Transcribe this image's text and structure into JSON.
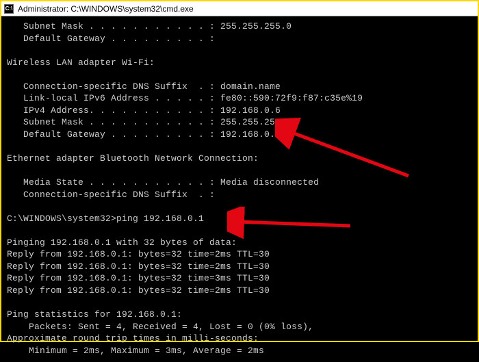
{
  "window": {
    "title": "Administrator: C:\\WINDOWS\\system32\\cmd.exe",
    "icon_label": "C:\\"
  },
  "terminal_lines": [
    "   Subnet Mask . . . . . . . . . . . : 255.255.255.0",
    "   Default Gateway . . . . . . . . . :",
    "",
    "Wireless LAN adapter Wi-Fi:",
    "",
    "   Connection-specific DNS Suffix  . : domain.name",
    "   Link-local IPv6 Address . . . . . : fe80::590:72f9:f87:c35e%19",
    "   IPv4 Address. . . . . . . . . . . : 192.168.0.6",
    "   Subnet Mask . . . . . . . . . . . : 255.255.255.0",
    "   Default Gateway . . . . . . . . . : 192.168.0.1",
    "",
    "Ethernet adapter Bluetooth Network Connection:",
    "",
    "   Media State . . . . . . . . . . . : Media disconnected",
    "   Connection-specific DNS Suffix  . :",
    "",
    "C:\\WINDOWS\\system32>ping 192.168.0.1",
    "",
    "Pinging 192.168.0.1 with 32 bytes of data:",
    "Reply from 192.168.0.1: bytes=32 time=2ms TTL=30",
    "Reply from 192.168.0.1: bytes=32 time=2ms TTL=30",
    "Reply from 192.168.0.1: bytes=32 time=3ms TTL=30",
    "Reply from 192.168.0.1: bytes=32 time=2ms TTL=30",
    "",
    "Ping statistics for 192.168.0.1:",
    "    Packets: Sent = 4, Received = 4, Lost = 0 (0% loss),",
    "Approximate round trip times in milli-seconds:",
    "    Minimum = 2ms, Maximum = 3ms, Average = 2ms"
  ],
  "annotations": {
    "arrow_color": "#e30613"
  }
}
